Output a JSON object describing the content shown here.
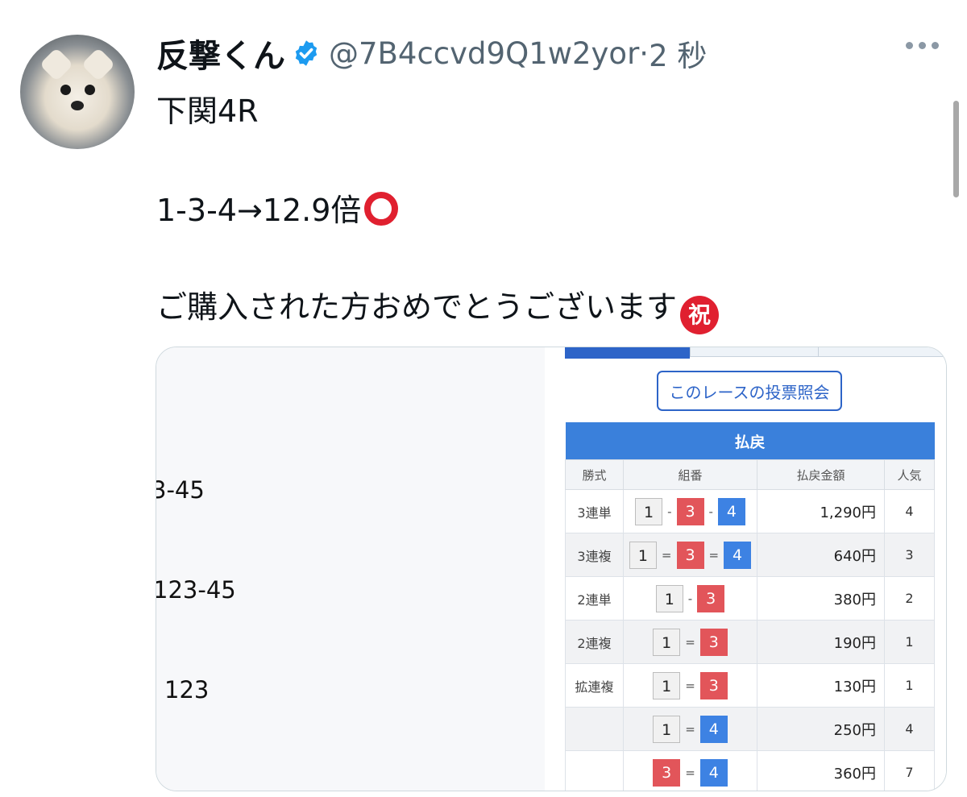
{
  "tweet": {
    "display_name": "反撃くん",
    "handle": "@7B4ccvd9Q1w2yor",
    "separator": "·",
    "time": "2 秒",
    "lines": [
      "下関4R",
      "1-3-4→12.9倍",
      "ご購入された方おめでとうございます"
    ],
    "emoji_circle": "heavy-large-circle",
    "emoji_iwai": "祝"
  },
  "media": {
    "left_fragments": [
      "3-45",
      "123-45",
      "123"
    ],
    "inquiry_button": "このレースの投票照会",
    "table_title": "払戻",
    "columns": [
      "勝式",
      "組番",
      "払戻金額",
      "人気"
    ],
    "rows": [
      {
        "kind": "3連単",
        "nums": [
          "1",
          "3",
          "4"
        ],
        "sep": "-",
        "amount": "1,290円",
        "pop": "4"
      },
      {
        "kind": "3連複",
        "nums": [
          "1",
          "3",
          "4"
        ],
        "sep": "=",
        "amount": "640円",
        "pop": "3"
      },
      {
        "kind": "2連単",
        "nums": [
          "1",
          "3"
        ],
        "sep": "-",
        "amount": "380円",
        "pop": "2"
      },
      {
        "kind": "2連複",
        "nums": [
          "1",
          "3"
        ],
        "sep": "=",
        "amount": "190円",
        "pop": "1"
      },
      {
        "kind": "拡連複",
        "nums": [
          "1",
          "3"
        ],
        "sep": "=",
        "amount": "130円",
        "pop": "1"
      },
      {
        "kind": "",
        "nums": [
          "1",
          "4"
        ],
        "sep": "=",
        "amount": "250円",
        "pop": "4"
      },
      {
        "kind": "",
        "nums": [
          "3",
          "4"
        ],
        "sep": "=",
        "amount": "360円",
        "pop": "7"
      }
    ]
  },
  "colors": {
    "boat1": "#f1f1f1",
    "boat3": "#e2555a",
    "boat4": "#3d82e3",
    "header_blue": "#3a80db",
    "verified": "#1d9bf0"
  }
}
